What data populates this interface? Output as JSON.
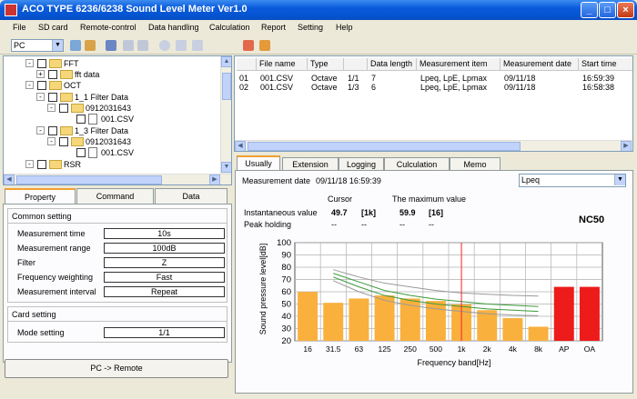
{
  "window": {
    "title": "ACO TYPE 6236/6238 Sound Level Meter Ver1.0",
    "min": "_",
    "max": "□",
    "close": "×"
  },
  "menu": [
    "File",
    "SD card",
    "Remote-control",
    "Data handling",
    "Calculation",
    "Report",
    "Setting",
    "Help"
  ],
  "toolbar": {
    "device": "PC"
  },
  "tree": {
    "fft": "FFT",
    "fft_data": "fft data",
    "oct": "OCT",
    "filter_1_1": "1_1 Filter Data",
    "date_1": "0912031643",
    "file_1": "001.CSV",
    "filter_1_3": "1_3 Filter Data",
    "date_2": "0912031643",
    "file_2": "001.CSV",
    "rsr": "RSR"
  },
  "left_tabs": [
    "Property",
    "Command",
    "Data"
  ],
  "common_setting": {
    "title": "Common setting",
    "rows": [
      {
        "label": "Measurement time",
        "value": "10s"
      },
      {
        "label": "Measurement range",
        "value": "100dB"
      },
      {
        "label": "Filter",
        "value": "Z"
      },
      {
        "label": "Frequency weighting",
        "value": "Fast"
      },
      {
        "label": "Measurement interval",
        "value": "Repeat"
      }
    ]
  },
  "card_setting": {
    "title": "Card setting",
    "mode_label": "Mode setting",
    "mode_value": "1/1"
  },
  "pc_remote_button": "PC -> Remote",
  "grid": {
    "headers": [
      "",
      "File name",
      "Type",
      "",
      "Data length",
      "Measurement item",
      "Measurement date",
      "Start time"
    ],
    "rows": [
      [
        "01",
        "001.CSV",
        "Octave",
        "1/1",
        "7",
        "Lpeq, LpE, Lpmax",
        "09/11/18",
        "16:59:39"
      ],
      [
        "02",
        "001.CSV",
        "Octave",
        "1/3",
        "6",
        "Lpeq, LpE, Lpmax",
        "09/11/18",
        "16:58:38"
      ]
    ]
  },
  "right_tabs": [
    "Usually",
    "Extension",
    "Logging",
    "Culculation",
    "Memo"
  ],
  "detail": {
    "measurement_date_label": "Measurement date",
    "measurement_date_value": "09/11/18 16:59:39",
    "select_value": "Lpeq",
    "cursor_label": "Cursor",
    "max_label": "The maximum value",
    "instant_label": "Instantaneous value",
    "cursor_value": "49.7",
    "cursor_band": "[1k]",
    "max_value": "59.9",
    "max_band": "[16]",
    "peak_label": "Peak holding",
    "peak_cursor_value": "--",
    "peak_cursor_band": "--",
    "peak_max_value": "--",
    "peak_max_band": "--",
    "nc_label": "NC50"
  },
  "chart_data": {
    "type": "bar",
    "ylabel": "Sound pressure level[dB]",
    "xlabel": "Frequency band[Hz]",
    "ylim": [
      20,
      100
    ],
    "yticks": [
      20,
      30,
      40,
      50,
      60,
      70,
      80,
      90,
      100
    ],
    "categories": [
      "16",
      "31.5",
      "63",
      "125",
      "250",
      "500",
      "1k",
      "2k",
      "4k",
      "8k",
      "AP",
      "OA"
    ],
    "values": [
      59.9,
      51,
      54.5,
      57,
      54.5,
      52.5,
      49.7,
      45,
      38.5,
      31.5,
      64,
      64
    ],
    "bar_colors": [
      "#f9b03d",
      "#f9b03d",
      "#f9b03d",
      "#f9b03d",
      "#f9b03d",
      "#f9b03d",
      "#f9b03d",
      "#f9b03d",
      "#f9b03d",
      "#f9b03d",
      "#ee1b1b",
      "#ee1b1b"
    ],
    "cursor_band": "1k",
    "nc_curves": [
      {
        "color": "#999999",
        "points": [
          [
            1,
            78
          ],
          [
            2,
            72
          ],
          [
            3,
            67
          ],
          [
            4,
            64
          ],
          [
            5,
            61
          ],
          [
            6,
            59
          ],
          [
            7,
            58
          ],
          [
            8,
            57
          ],
          [
            9,
            56.5
          ]
        ]
      },
      {
        "color": "#3a9a3a",
        "points": [
          [
            1,
            75
          ],
          [
            2,
            68
          ],
          [
            3,
            61
          ],
          [
            4,
            57
          ],
          [
            5,
            54
          ],
          [
            6,
            52
          ],
          [
            7,
            50
          ],
          [
            8,
            49
          ],
          [
            9,
            48
          ]
        ]
      },
      {
        "color": "#3a9a3a",
        "points": [
          [
            1,
            72
          ],
          [
            2,
            64
          ],
          [
            3,
            57
          ],
          [
            4,
            53
          ],
          [
            5,
            50
          ],
          [
            6,
            48
          ],
          [
            7,
            46
          ],
          [
            8,
            45
          ],
          [
            9,
            44
          ]
        ]
      },
      {
        "color": "#999999",
        "points": [
          [
            1,
            69
          ],
          [
            2,
            60
          ],
          [
            3,
            53
          ],
          [
            4,
            49
          ],
          [
            5,
            46
          ],
          [
            6,
            44
          ],
          [
            7,
            42
          ],
          [
            8,
            41
          ],
          [
            9,
            40.5
          ]
        ]
      }
    ],
    "grid": true
  }
}
